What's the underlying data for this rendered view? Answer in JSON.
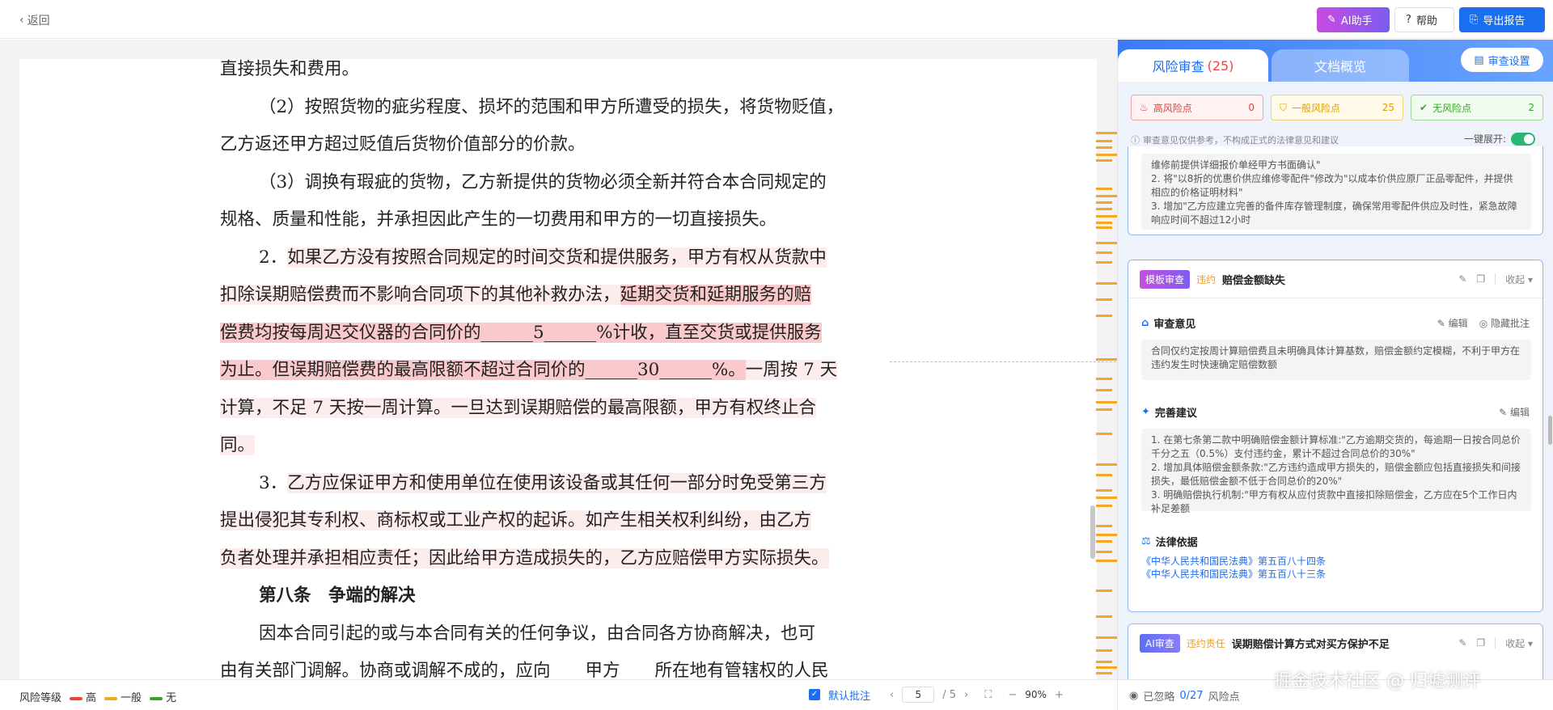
{
  "topbar": {
    "back": "返回",
    "ai_btn": "AI助手",
    "help_btn": "帮助",
    "export_btn": "导出报告"
  },
  "document": {
    "line0": "直接损失和费用。",
    "p1a": "（2）按照货物的疵劣程度、损坏的范围和甲方所遭受的损失，将货物贬值，",
    "p1b": "乙方返还甲方超过贬值后货物价值部分的价款。",
    "p2a": "（3）调换有瑕疵的货物，乙方新提供的货物必须全新并符合本合同规定的",
    "p2b": "规格、质量和性能，并承担因此产生的一切费用和甲方的一切直接损失。",
    "p3_num": "2．",
    "p3a": "如果乙方没有按照合同规定的时间交货和提供服务，甲方有权从货款中",
    "p3b": "扣除误期赔偿费而不影响合同项下的其他补救办法，",
    "p3b_hl": "延期交货和延期服务的赔",
    "p3c": "偿费均按每周迟交仪器的合同价的______5______%计收，直至交货或提供服务",
    "p3d": "为止。但误期赔偿费的最高限额不超过合同价的______30______%。",
    "p3d_tail": "一周按 7 天",
    "p3e": "计算，不足 7 天按一周计算。一旦达到误期赔偿的最高限额，甲方有权终止合",
    "p3f": "同。",
    "p4_num": "3．",
    "p4a": "乙方应保证甲方和使用单位在使用该设备或其任何一部分时免受第三方",
    "p4b": "提出侵犯其专利权、商标权或工业产权的起诉。如产生相关权利纠纷，由乙方",
    "p4c": "负者处理并承担相应责任；因此给甲方造成损失的，乙方应赔偿甲方实际损失。",
    "article8": "第八条　争端的解决",
    "p5a": "因本合同引起的或与本合同有关的任何争议，由合同各方协商解决，也可",
    "p5b": "由有关部门调解。协商或调解不成的，应向　　甲方　　所在地有管辖权的人民"
  },
  "statusbar": {
    "legend_title": "风险等级",
    "legend": [
      {
        "label": "高",
        "color": "#f04444"
      },
      {
        "label": "一般",
        "color": "#f5a623"
      },
      {
        "label": "无",
        "color": "#3aa52b"
      }
    ],
    "default_note": "默认批注",
    "page_current": "5",
    "page_total": "/ 5",
    "zoom": "90%"
  },
  "panel": {
    "tab_risk": "风险审查",
    "tab_risk_count": "(25)",
    "tab_overview": "文档概览",
    "settings": "审查设置",
    "risk_high": {
      "label": "高风险点",
      "count": "0"
    },
    "risk_mid": {
      "label": "一般风险点",
      "count": "25"
    },
    "risk_low": {
      "label": "无风险点",
      "count": "2"
    },
    "notice": "审查意见仅供参考，不构成正式的法律意见和建议",
    "expand_all": "一键展开:",
    "card1_text": "维修前提供详细报价单经甲方书面确认\"\n2. 将\"以8折的优惠价供应维修零配件\"修改为\"以成本价供应原厂正品零配件，并提供相应的价格证明材料\"\n3. 增加\"乙方应建立完善的备件库存管理制度，确保常用零配件供应及时性，紧急故障响应时间不超过12小时",
    "card2": {
      "tag": "模板审查",
      "type": "违约",
      "title": "赔偿金额缺失",
      "collapse": "收起",
      "opinion_title": "审查意见",
      "edit": "编辑",
      "hide_note": "隐藏批注",
      "opinion": "合同仅约定按周计算赔偿费且未明确具体计算基数，赔偿金额约定模糊，不利于甲方在违约发生时快速确定赔偿数额",
      "suggest_title": "完善建议",
      "suggest": "1. 在第七条第二款中明确赔偿金额计算标准:\"乙方逾期交货的，每逾期一日按合同总价千分之五（0.5%）支付违约金，累计不超过合同总价的30%\"\n2. 增加具体赔偿金额条款:\"乙方违约造成甲方损失的，赔偿金额应包括直接损失和间接损失，最低赔偿金额不低于合同总价的20%\"\n3. 明确赔偿执行机制:\"甲方有权从应付货款中直接扣除赔偿金，乙方应在5个工作日内补足差额",
      "law_title": "法律依据",
      "law1": "《中华人民共和国民法典》第五百八十四条",
      "law2": "《中华人民共和国民法典》第五百八十三条"
    },
    "card3": {
      "tag": "AI审查",
      "type": "违约责任",
      "title": "误期赔偿计算方式对买方保护不足",
      "collapse": "收起"
    },
    "footer_ignored": "已忽略",
    "footer_count": "0/27",
    "footer_label": "风险点"
  },
  "watermark": "掘金技术社区 @ 归墟测评"
}
